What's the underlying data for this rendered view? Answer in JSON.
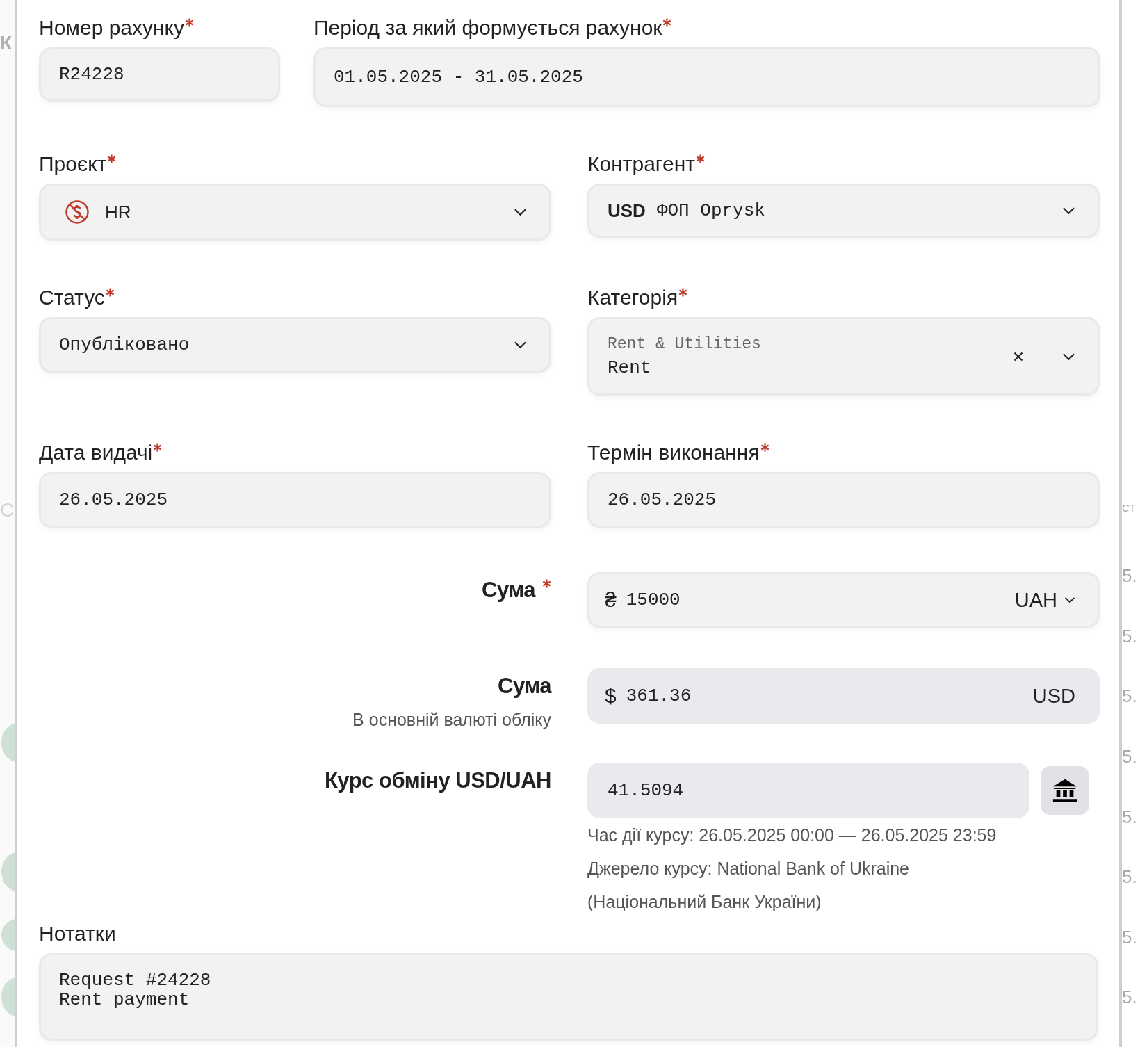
{
  "background": {
    "left_fragments": [
      "К",
      "С"
    ],
    "right_fragments": [
      "СТ",
      "5.",
      "5.",
      "5.",
      "5.",
      "5.",
      "5.",
      "5.",
      "5."
    ]
  },
  "invoice_number": {
    "label": "Номер рахунку",
    "required": true,
    "value": "R24228"
  },
  "period": {
    "label": "Період за який формується рахунок",
    "required": true,
    "value": "01.05.2025 - 31.05.2025"
  },
  "project": {
    "label": "Проєкт",
    "required": true,
    "value": "HR"
  },
  "counterparty": {
    "label": "Контрагент",
    "required": true,
    "currency": "USD",
    "value": "ФОП Oprysk"
  },
  "status": {
    "label": "Статус",
    "required": true,
    "value": "Опубліковано"
  },
  "category": {
    "label": "Категорія",
    "required": true,
    "parent": "Rent & Utilities",
    "value": "Rent"
  },
  "issue_date": {
    "label": "Дата видачі",
    "required": true,
    "value": "26.05.2025"
  },
  "due_date": {
    "label": "Термін виконання",
    "required": true,
    "value": "26.05.2025"
  },
  "amount": {
    "label": "Сума",
    "required": true,
    "symbol": "₴",
    "value": "15000",
    "currency": "UAH"
  },
  "base_amount": {
    "label": "Сума",
    "hint": "В основній валюті обліку",
    "symbol": "$",
    "value": "361.36",
    "currency": "USD"
  },
  "rate": {
    "label": "Курс обміну USD/UAH",
    "value": "41.5094",
    "validity": "Час дії курсу: 26.05.2025 00:00 — 26.05.2025 23:59",
    "source": "Джерело курсу: National Bank of Ukraine (Національний Банк України)"
  },
  "notes": {
    "label": "Нотатки",
    "lines": [
      "Request #24228",
      "Rent payment"
    ]
  }
}
